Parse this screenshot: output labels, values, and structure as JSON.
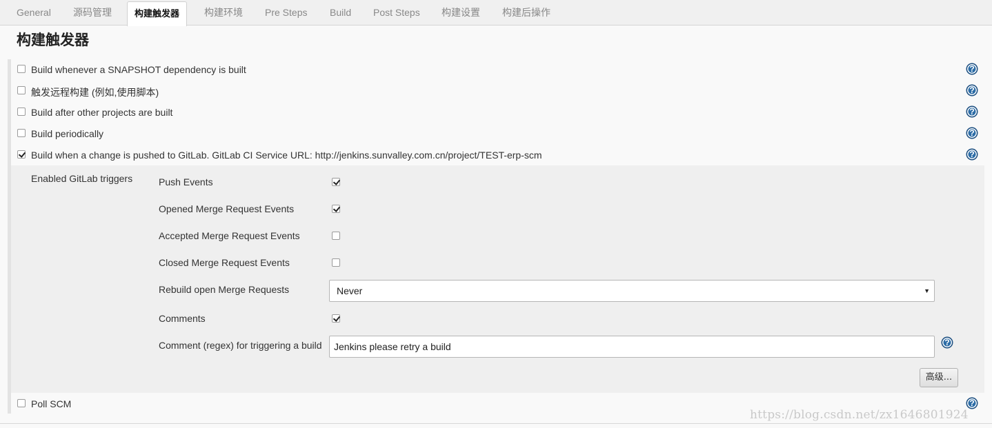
{
  "tabs": [
    {
      "label": "General"
    },
    {
      "label": "源码管理"
    },
    {
      "label": "构建触发器"
    },
    {
      "label": "构建环境"
    },
    {
      "label": "Pre Steps"
    },
    {
      "label": "Build"
    },
    {
      "label": "Post Steps"
    },
    {
      "label": "构建设置"
    },
    {
      "label": "构建后操作"
    }
  ],
  "active_tab": "构建触发器",
  "section": {
    "title": "构建触发器"
  },
  "triggers": [
    {
      "label": "Build whenever a SNAPSHOT dependency is built",
      "checked": false
    },
    {
      "label": "触发远程构建 (例如,使用脚本)",
      "checked": false
    },
    {
      "label": "Build after other projects are built",
      "checked": false
    },
    {
      "label": "Build periodically",
      "checked": false
    },
    {
      "label": "Build when a change is pushed to GitLab. GitLab CI Service URL: http://jenkins.sunvalley.com.cn/project/TEST-erp-scm",
      "checked": true
    },
    {
      "label": "Poll SCM",
      "checked": false
    }
  ],
  "gitlab": {
    "group_label": "Enabled GitLab triggers",
    "events": [
      {
        "label": "Push Events",
        "checked": true
      },
      {
        "label": "Opened Merge Request Events",
        "checked": true
      },
      {
        "label": "Accepted Merge Request Events",
        "checked": false
      },
      {
        "label": "Closed Merge Request Events",
        "checked": false
      }
    ],
    "rebuild": {
      "label": "Rebuild open Merge Requests",
      "value": "Never"
    },
    "comments": {
      "label": "Comments",
      "checked": true
    },
    "comment_regex": {
      "label": "Comment (regex) for triggering a build",
      "value": "Jenkins please retry a build"
    },
    "advanced_label": "高级..."
  },
  "help_glyph": "?",
  "select_arrow_glyph": "▼",
  "watermark": "https://blog.csdn.net/zx1646801924",
  "colors": {
    "help_icon": "#2c6ca6",
    "active_tab_bg": "#ffffff",
    "gitlab_block_bg": "#efefef"
  }
}
